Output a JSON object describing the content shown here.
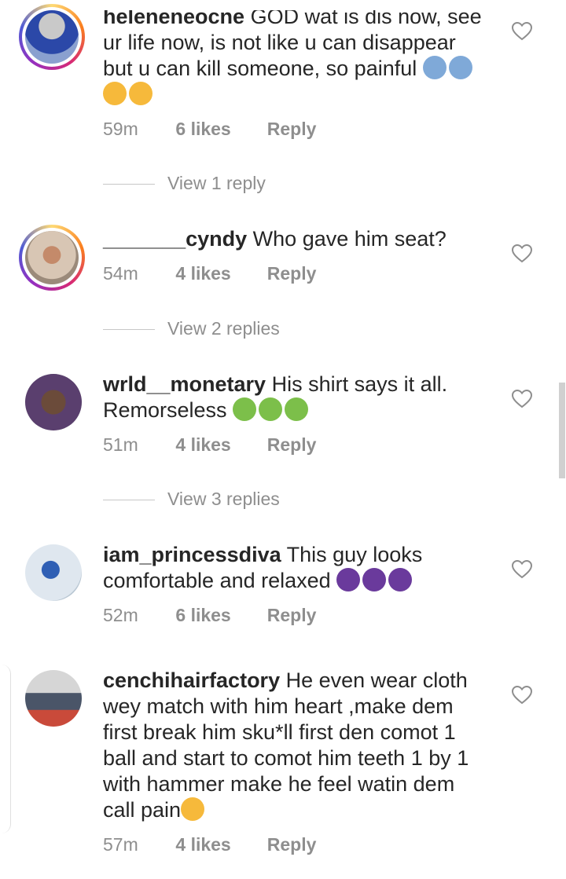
{
  "comments": [
    {
      "username": "heleneneocne",
      "text": "GOD wat is dis now, see ur life now, is not like u can disappear but u can kill someone, so painful",
      "emojis": [
        "downcast-sweat",
        "downcast-sweat",
        "worried",
        "worried"
      ],
      "time": "59m",
      "likes": "6 likes",
      "reply": "Reply",
      "view_replies": "View 1 reply"
    },
    {
      "username": "_______cyndy",
      "text": "Who gave him seat?",
      "time": "54m",
      "likes": "4 likes",
      "reply": "Reply",
      "view_replies": "View 2 replies"
    },
    {
      "username": "wrld__monetary",
      "text": "His shirt says it all. Remorseless",
      "emojis": [
        "nauseated",
        "nauseated",
        "nauseated"
      ],
      "time": "51m",
      "likes": "4 likes",
      "reply": "Reply",
      "view_replies": "View 3 replies"
    },
    {
      "username": "iam_princessdiva",
      "text": "This guy looks comfortable and relaxed",
      "emojis": [
        "facepalm",
        "facepalm",
        "facepalm"
      ],
      "time": "52m",
      "likes": "6 likes",
      "reply": "Reply"
    },
    {
      "username": "cenchihairfactory",
      "text": "He even wear cloth wey match with him heart ,make dem first break him sku*ll first den comot 1 ball and start to comot him teeth 1 by 1 with hammer make he feel watin dem call pain",
      "emojis": [
        "crying"
      ],
      "time": "57m",
      "likes": "4 likes",
      "reply": "Reply"
    }
  ],
  "colors": {
    "text": "#262626",
    "secondary": "#8e8e8e",
    "divider": "#c7c7c7"
  }
}
